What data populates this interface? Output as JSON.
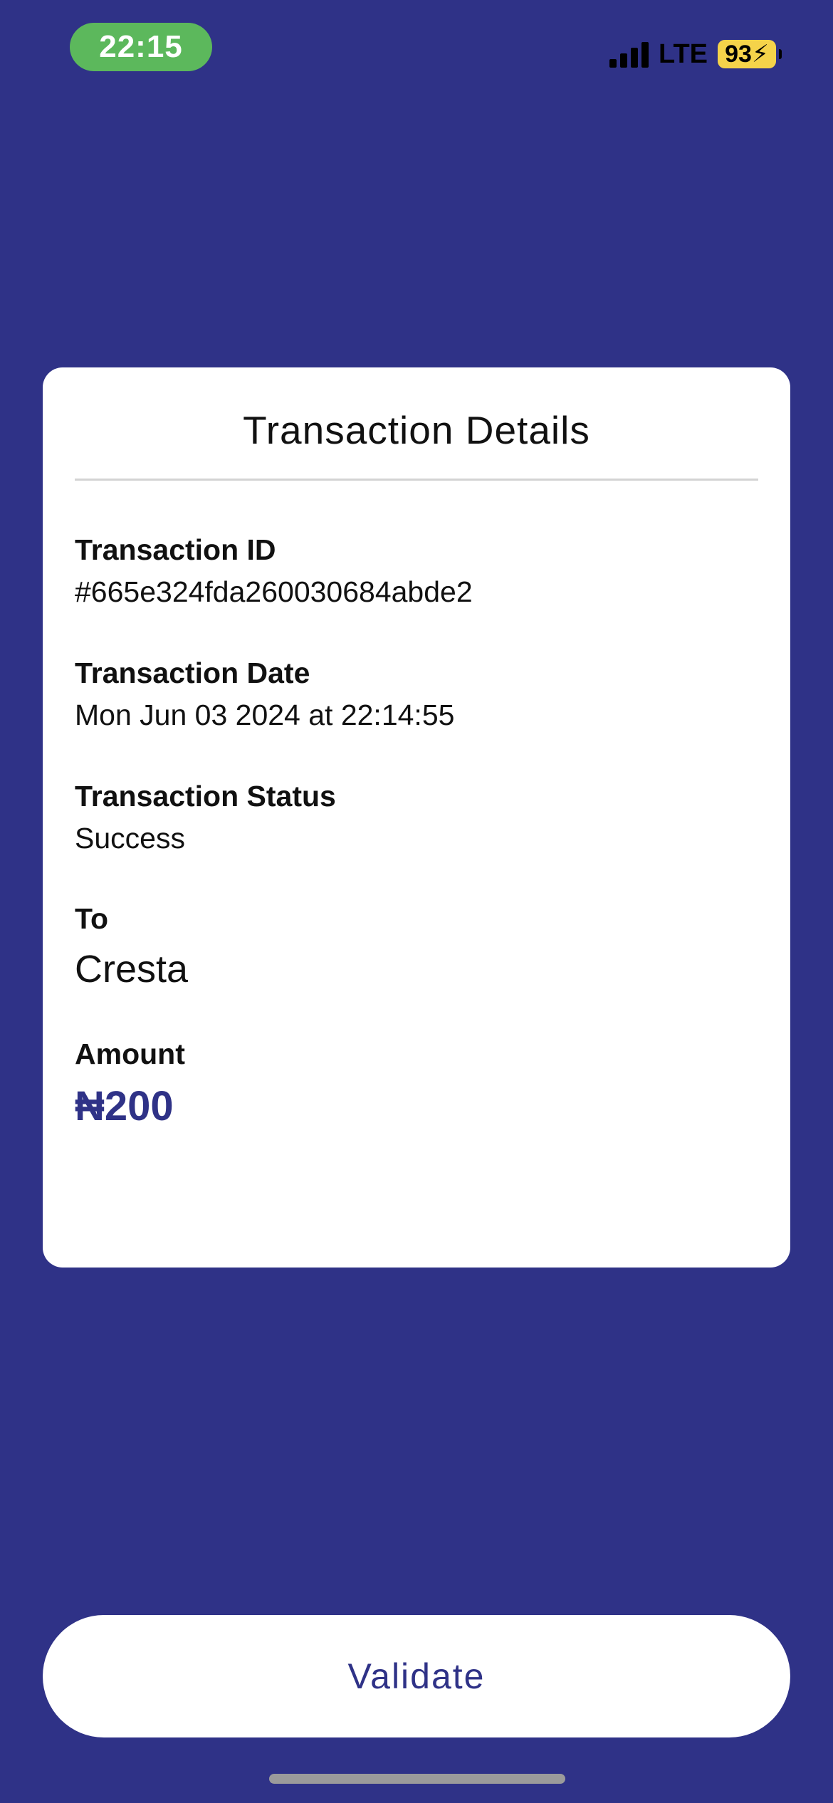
{
  "status_bar": {
    "time": "22:15",
    "network": "LTE",
    "battery": "93"
  },
  "card": {
    "title": "Transaction Details",
    "fields": [
      {
        "label": "Transaction ID",
        "value": "#665e324fda260030684abde2"
      },
      {
        "label": "Transaction Date",
        "value": "Mon Jun 03 2024 at 22:14:55"
      },
      {
        "label": "Transaction Status",
        "value": "Success"
      },
      {
        "label": "To",
        "value": "Cresta"
      },
      {
        "label": "Amount",
        "value": "₦200"
      }
    ]
  },
  "actions": {
    "validate_label": "Validate"
  },
  "colors": {
    "background": "#2f3287",
    "accent": "#2f3287",
    "card": "#ffffff",
    "time_pill": "#5cb85c",
    "battery": "#f5d34a"
  }
}
